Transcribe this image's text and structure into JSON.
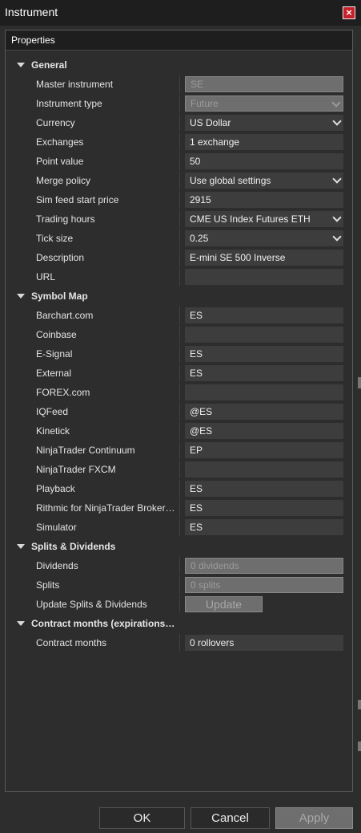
{
  "window": {
    "title": "Instrument",
    "close_label": "×"
  },
  "panel": {
    "header": "Properties"
  },
  "groups": [
    {
      "label": "General",
      "rows": [
        {
          "label": "Master instrument",
          "value": "SE",
          "type": "text",
          "disabled": true
        },
        {
          "label": "Instrument type",
          "value": "Future",
          "type": "combo",
          "disabled": true
        },
        {
          "label": "Currency",
          "value": "US Dollar",
          "type": "combo"
        },
        {
          "label": "Exchanges",
          "value": "1 exchange",
          "type": "text"
        },
        {
          "label": "Point value",
          "value": "50",
          "type": "text"
        },
        {
          "label": "Merge policy",
          "value": "Use global settings",
          "type": "combo"
        },
        {
          "label": "Sim feed start price",
          "value": "2915",
          "type": "text"
        },
        {
          "label": "Trading hours",
          "value": "CME US Index Futures ETH",
          "type": "combo"
        },
        {
          "label": "Tick size",
          "value": "0.25",
          "type": "combo"
        },
        {
          "label": "Description",
          "value": "E-mini SE 500 Inverse",
          "type": "text"
        },
        {
          "label": "URL",
          "value": "",
          "type": "text"
        }
      ]
    },
    {
      "label": "Symbol Map",
      "rows": [
        {
          "label": "Barchart.com",
          "value": "ES",
          "type": "text"
        },
        {
          "label": "Coinbase",
          "value": "",
          "type": "text"
        },
        {
          "label": "E-Signal",
          "value": "ES",
          "type": "text"
        },
        {
          "label": "External",
          "value": "ES",
          "type": "text"
        },
        {
          "label": "FOREX.com",
          "value": "",
          "type": "text"
        },
        {
          "label": "IQFeed",
          "value": "@ES",
          "type": "text"
        },
        {
          "label": "Kinetick",
          "value": "@ES",
          "type": "text"
        },
        {
          "label": "NinjaTrader Continuum",
          "value": "EP",
          "type": "text"
        },
        {
          "label": "NinjaTrader FXCM",
          "value": "",
          "type": "text"
        },
        {
          "label": "Playback",
          "value": "ES",
          "type": "text"
        },
        {
          "label": "Rithmic for NinjaTrader Brokerage",
          "value": "ES",
          "type": "text"
        },
        {
          "label": "Simulator",
          "value": "ES",
          "type": "text"
        }
      ]
    },
    {
      "label": "Splits & Dividends",
      "rows": [
        {
          "label": "Dividends",
          "value": "0 dividends",
          "type": "text",
          "disabled": true
        },
        {
          "label": "Splits",
          "value": "0 splits",
          "type": "text",
          "disabled": true
        },
        {
          "label": "Update Splits & Dividends",
          "value": "Update",
          "type": "button"
        }
      ]
    },
    {
      "label": "Contract months (expirations…",
      "rows": [
        {
          "label": "Contract months",
          "value": "0 rollovers",
          "type": "text"
        }
      ]
    }
  ],
  "footer": {
    "ok": "OK",
    "cancel": "Cancel",
    "apply": "Apply"
  }
}
